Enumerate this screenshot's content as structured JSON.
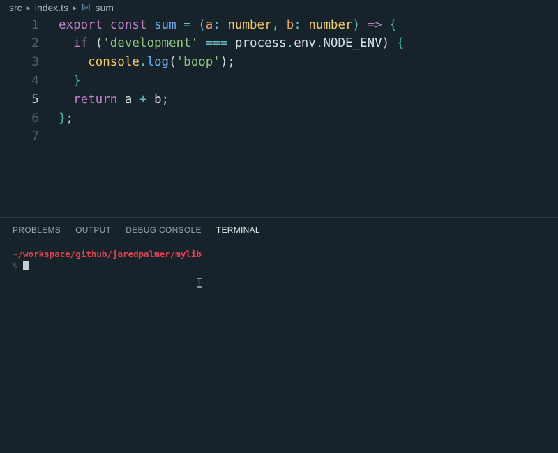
{
  "breadcrumb": {
    "folder": "src",
    "file": "index.ts",
    "symbol": "sum",
    "symbol_icon": "symbol-variable-icon"
  },
  "editor": {
    "active_line": 5,
    "line_numbers": [
      "1",
      "2",
      "3",
      "4",
      "5",
      "6",
      "7"
    ],
    "lines": [
      [
        {
          "t": "export",
          "c": "kw"
        },
        {
          "t": " ",
          "c": "plain"
        },
        {
          "t": "const",
          "c": "kw"
        },
        {
          "t": " ",
          "c": "plain"
        },
        {
          "t": "sum",
          "c": "fn"
        },
        {
          "t": " = ",
          "c": "op"
        },
        {
          "t": "(",
          "c": "op"
        },
        {
          "t": "a",
          "c": "param"
        },
        {
          "t": ": ",
          "c": "op"
        },
        {
          "t": "number",
          "c": "type"
        },
        {
          "t": ", ",
          "c": "op"
        },
        {
          "t": "b",
          "c": "param"
        },
        {
          "t": ": ",
          "c": "op"
        },
        {
          "t": "number",
          "c": "type"
        },
        {
          "t": ") ",
          "c": "op"
        },
        {
          "t": "=>",
          "c": "kw"
        },
        {
          "t": " ",
          "c": "plain"
        },
        {
          "t": "{",
          "c": "brace"
        }
      ],
      [
        {
          "t": "  ",
          "c": "plain"
        },
        {
          "t": "if",
          "c": "kw"
        },
        {
          "t": " (",
          "c": "plain"
        },
        {
          "t": "'development'",
          "c": "str"
        },
        {
          "t": " ",
          "c": "plain"
        },
        {
          "t": "===",
          "c": "op"
        },
        {
          "t": " ",
          "c": "plain"
        },
        {
          "t": "process",
          "c": "plain"
        },
        {
          "t": ".",
          "c": "op"
        },
        {
          "t": "env",
          "c": "plain"
        },
        {
          "t": ".",
          "c": "op"
        },
        {
          "t": "NODE_ENV",
          "c": "plain"
        },
        {
          "t": ") ",
          "c": "plain"
        },
        {
          "t": "{",
          "c": "brace"
        }
      ],
      [
        {
          "t": "    ",
          "c": "plain"
        },
        {
          "t": "console",
          "c": "obj"
        },
        {
          "t": ".",
          "c": "op"
        },
        {
          "t": "log",
          "c": "method"
        },
        {
          "t": "(",
          "c": "plain"
        },
        {
          "t": "'boop'",
          "c": "str"
        },
        {
          "t": ");",
          "c": "plain"
        }
      ],
      [
        {
          "t": "  ",
          "c": "plain"
        },
        {
          "t": "}",
          "c": "brace"
        }
      ],
      [
        {
          "t": "  ",
          "c": "plain"
        },
        {
          "t": "return",
          "c": "kw"
        },
        {
          "t": " a ",
          "c": "plain"
        },
        {
          "t": "+",
          "c": "op"
        },
        {
          "t": " b;",
          "c": "plain"
        }
      ],
      [
        {
          "t": "}",
          "c": "brace"
        },
        {
          "t": ";",
          "c": "plain"
        }
      ],
      []
    ]
  },
  "panel": {
    "tabs": [
      {
        "label": "PROBLEMS",
        "active": false
      },
      {
        "label": "OUTPUT",
        "active": false
      },
      {
        "label": "DEBUG CONSOLE",
        "active": false
      },
      {
        "label": "TERMINAL",
        "active": true
      }
    ]
  },
  "terminal": {
    "cwd": "~/workspace/github/jaredpalmer/mylib",
    "prompt": "$"
  },
  "colors": {
    "background": "#17232b",
    "path_red": "#e8404f",
    "keyword": "#c27ec9",
    "function": "#6ab0f3",
    "string": "#8ec67a",
    "type": "#f6c863"
  }
}
